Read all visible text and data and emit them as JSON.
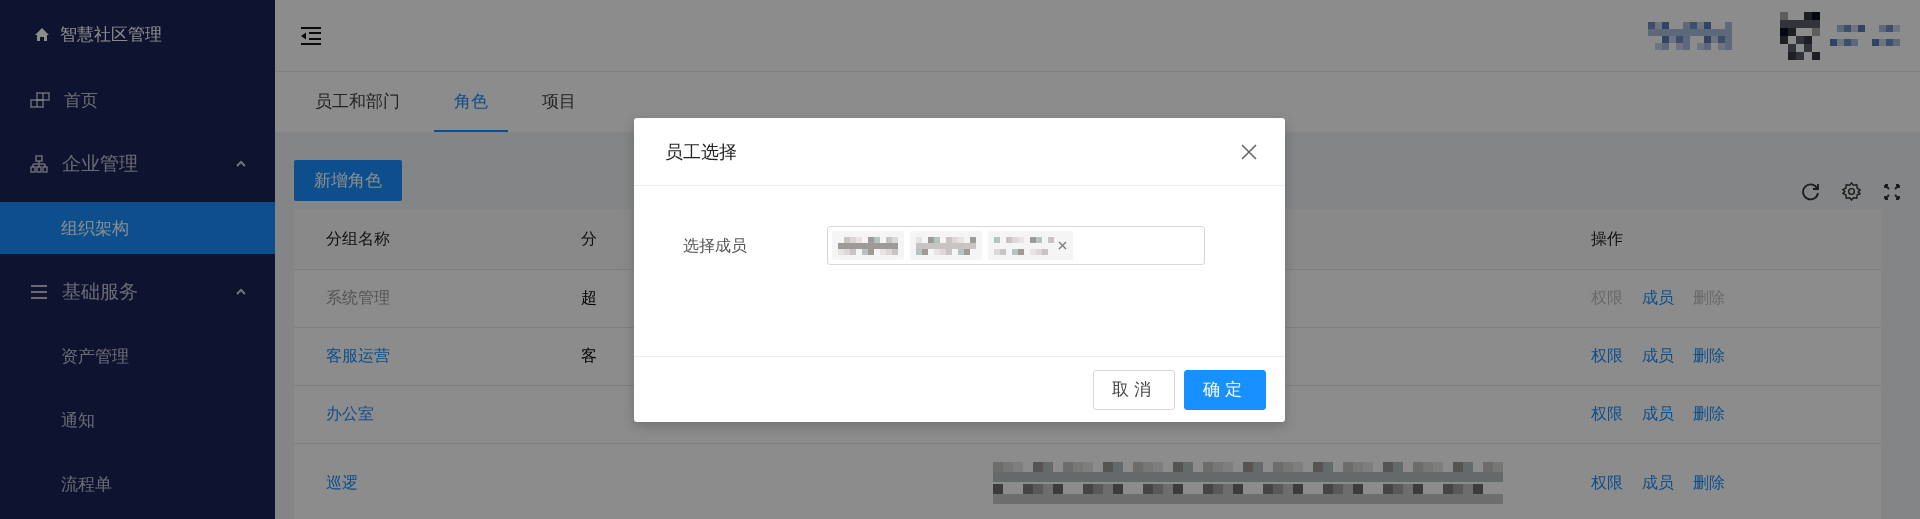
{
  "sidebar": {
    "brand": "智慧社区管理",
    "items": [
      {
        "kind": "link",
        "label": "首页",
        "selected": false
      },
      {
        "kind": "group",
        "label": "企业管理",
        "expanded": true,
        "children": [
          {
            "label": "组织架构",
            "selected": true
          }
        ]
      },
      {
        "kind": "group",
        "label": "基础服务",
        "expanded": true,
        "children": [
          {
            "label": "资产管理",
            "selected": false
          },
          {
            "label": "通知",
            "selected": false
          },
          {
            "label": "流程单",
            "selected": false
          }
        ]
      }
    ]
  },
  "tabs": [
    {
      "label": "员工和部门",
      "selected": false
    },
    {
      "label": "角色",
      "selected": true
    },
    {
      "label": "项目",
      "selected": false
    }
  ],
  "toolbar": {
    "add_button": "新增角色"
  },
  "table": {
    "columns": [
      {
        "label": "分组名称"
      },
      {
        "label": "分"
      },
      {
        "label": "操作"
      }
    ],
    "rows": [
      {
        "name": "系统管理",
        "system": true,
        "column_2": "超",
        "blurred_text": false,
        "actions": [
          {
            "label": "权限",
            "disabled": true
          },
          {
            "label": "成员",
            "disabled": false
          },
          {
            "label": "删除",
            "disabled": true
          }
        ]
      },
      {
        "name": "客服运营",
        "system": false,
        "column_2": "客",
        "blurred_text": false,
        "actions": [
          {
            "label": "权限",
            "disabled": false
          },
          {
            "label": "成员",
            "disabled": false
          },
          {
            "label": "删除",
            "disabled": false
          }
        ]
      },
      {
        "name": "办公室",
        "system": false,
        "blurred_text": false,
        "actions": [
          {
            "label": "权限",
            "disabled": false
          },
          {
            "label": "成员",
            "disabled": false
          },
          {
            "label": "删除",
            "disabled": false
          }
        ]
      },
      {
        "name": "巡逻",
        "system": false,
        "blurred_text": true,
        "actions": [
          {
            "label": "权限",
            "disabled": false
          },
          {
            "label": "成员",
            "disabled": false
          },
          {
            "label": "删除",
            "disabled": false
          }
        ]
      }
    ]
  },
  "dialog": {
    "title": "员工选择",
    "label": "选择成员",
    "members": [
      {
        "closable": false
      },
      {
        "closable": false
      },
      {
        "closable": true
      }
    ],
    "cancel": "取消",
    "ok": "确定"
  }
}
